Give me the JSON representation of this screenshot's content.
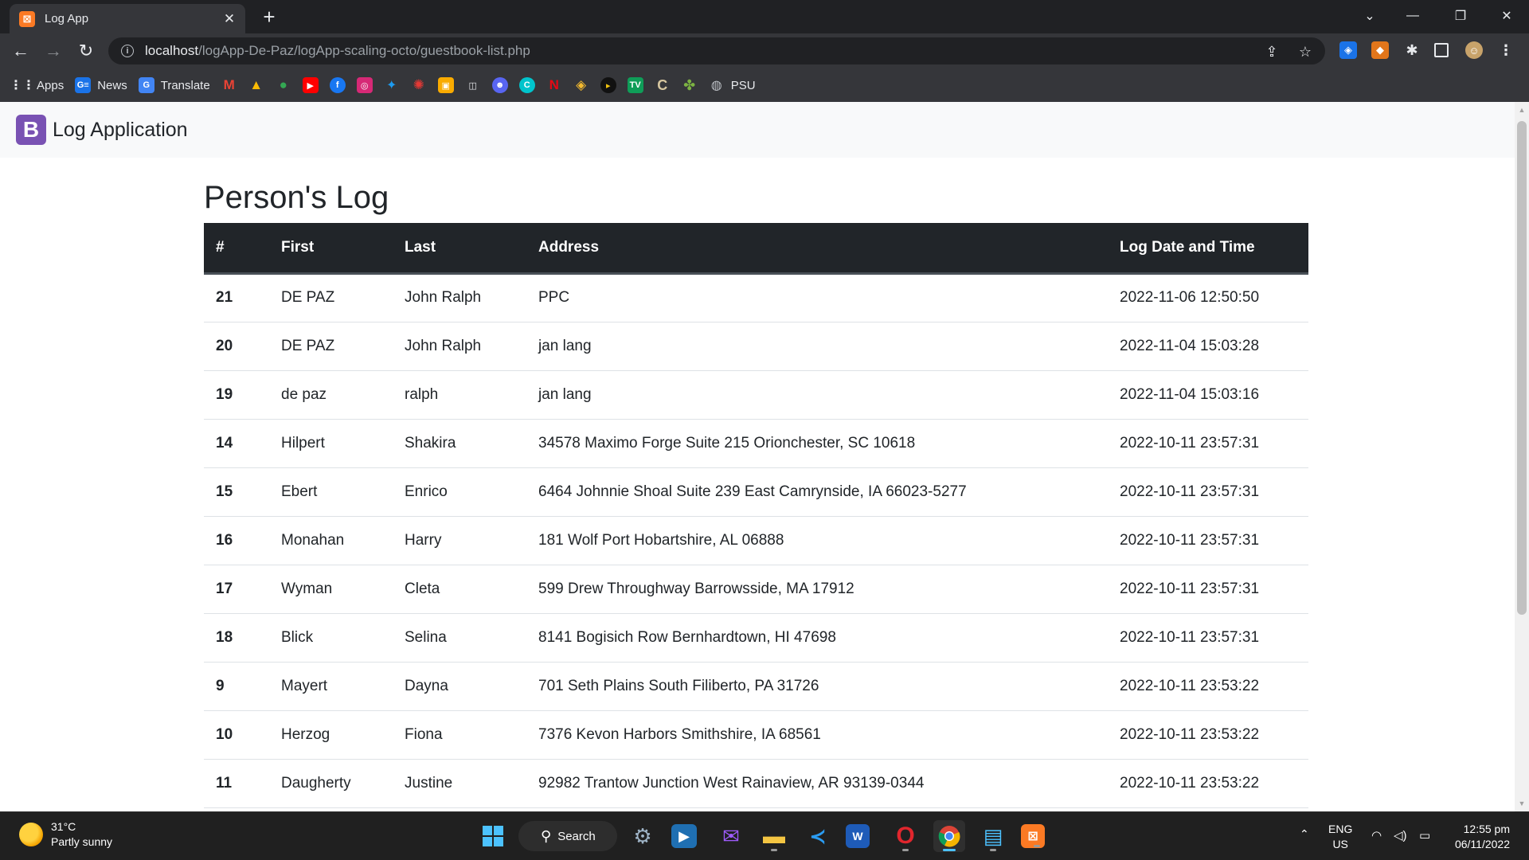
{
  "browser": {
    "tab_title": "Log App",
    "url_host": "localhost",
    "url_path": "/logApp-De-Paz/logApp-scaling-octo/guestbook-list.php",
    "bookmarks": [
      {
        "label": "Apps",
        "icon": "apps-grid-icon"
      },
      {
        "label": "News",
        "icon": "google-news-icon"
      },
      {
        "label": "Translate",
        "icon": "google-translate-icon"
      },
      {
        "label": "",
        "icon": "gmail-icon"
      },
      {
        "label": "",
        "icon": "google-drive-icon"
      },
      {
        "label": "",
        "icon": "google-maps-icon"
      },
      {
        "label": "",
        "icon": "youtube-icon"
      },
      {
        "label": "",
        "icon": "facebook-icon"
      },
      {
        "label": "",
        "icon": "instagram-icon"
      },
      {
        "label": "",
        "icon": "twitter-icon"
      },
      {
        "label": "",
        "icon": "target-icon"
      },
      {
        "label": "",
        "icon": "photo-icon"
      },
      {
        "label": "",
        "icon": "classroom-icon"
      },
      {
        "label": "",
        "icon": "discord-icon"
      },
      {
        "label": "",
        "icon": "canva-icon"
      },
      {
        "label": "",
        "icon": "netflix-icon"
      },
      {
        "label": "",
        "icon": "binance-icon"
      },
      {
        "label": "",
        "icon": "play-icon"
      },
      {
        "label": "",
        "icon": "tv-icon"
      },
      {
        "label": "",
        "icon": "c-icon"
      },
      {
        "label": "",
        "icon": "clover-icon"
      },
      {
        "label": "PSU",
        "icon": "globe-icon"
      }
    ]
  },
  "navbar": {
    "brand_letter": "B",
    "brand_text": "Log Application"
  },
  "page": {
    "heading": "Person's Log",
    "columns": [
      "#",
      "First",
      "Last",
      "Address",
      "Log Date and Time"
    ],
    "rows": [
      {
        "id": "21",
        "first": "DE PAZ",
        "last": "John Ralph",
        "address": "PPC",
        "datetime": "2022-11-06 12:50:50"
      },
      {
        "id": "20",
        "first": "DE PAZ",
        "last": "John Ralph",
        "address": "jan lang",
        "datetime": "2022-11-04 15:03:28"
      },
      {
        "id": "19",
        "first": "de paz",
        "last": "ralph",
        "address": "jan lang",
        "datetime": "2022-11-04 15:03:16"
      },
      {
        "id": "14",
        "first": "Hilpert",
        "last": "Shakira",
        "address": "34578 Maximo Forge Suite 215 Orionchester, SC 10618",
        "datetime": "2022-10-11 23:57:31"
      },
      {
        "id": "15",
        "first": "Ebert",
        "last": "Enrico",
        "address": "6464 Johnnie Shoal Suite 239 East Camrynside, IA 66023-5277",
        "datetime": "2022-10-11 23:57:31"
      },
      {
        "id": "16",
        "first": "Monahan",
        "last": "Harry",
        "address": "181 Wolf Port Hobartshire, AL 06888",
        "datetime": "2022-10-11 23:57:31"
      },
      {
        "id": "17",
        "first": "Wyman",
        "last": "Cleta",
        "address": "599 Drew Throughway Barrowsside, MA 17912",
        "datetime": "2022-10-11 23:57:31"
      },
      {
        "id": "18",
        "first": "Blick",
        "last": "Selina",
        "address": "8141 Bogisich Row Bernhardtown, HI 47698",
        "datetime": "2022-10-11 23:57:31"
      },
      {
        "id": "9",
        "first": "Mayert",
        "last": "Dayna",
        "address": "701 Seth Plains South Filiberto, PA 31726",
        "datetime": "2022-10-11 23:53:22"
      },
      {
        "id": "10",
        "first": "Herzog",
        "last": "Fiona",
        "address": "7376 Kevon Harbors Smithshire, IA 68561",
        "datetime": "2022-10-11 23:53:22"
      },
      {
        "id": "11",
        "first": "Daugherty",
        "last": "Justine",
        "address": "92982 Trantow Junction West Rainaview, AR 93139-0344",
        "datetime": "2022-10-11 23:53:22"
      }
    ]
  },
  "taskbar": {
    "weather_temp": "31°C",
    "weather_desc": "Partly sunny",
    "search_label": "Search",
    "lang_top": "ENG",
    "lang_bottom": "US",
    "time": "12:55 pm",
    "date": "06/11/2022"
  },
  "colors": {
    "brand": "#7952b3",
    "table_header": "#212529",
    "chrome_dark": "#202124",
    "chrome_toolbar": "#35363a"
  }
}
